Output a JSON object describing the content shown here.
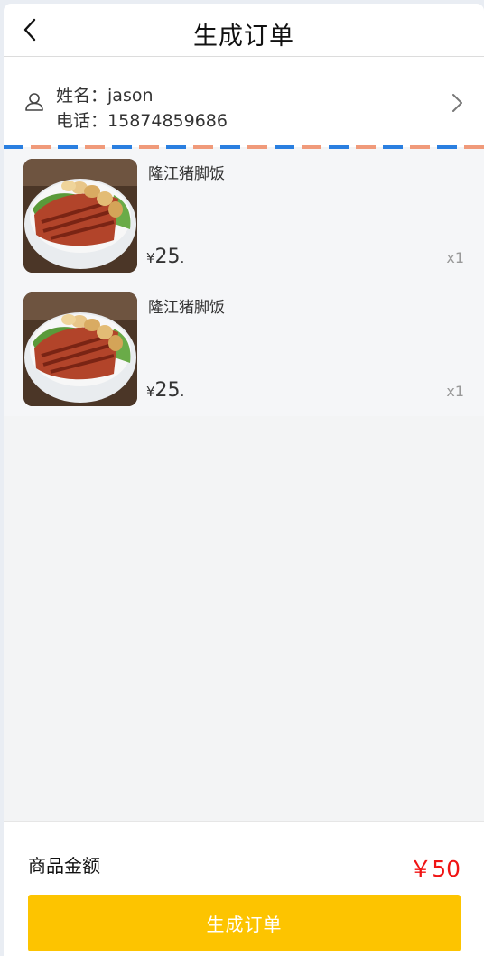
{
  "header": {
    "title": "生成订单",
    "back_icon": "chevron-left-icon"
  },
  "address": {
    "user_icon": "user-icon",
    "name_label": "姓名：",
    "name": "jason",
    "phone_label": "电话：",
    "phone": "15874859686",
    "arrow_icon": "chevron-right-icon"
  },
  "items": [
    {
      "name": "隆江猪脚饭",
      "currency": "¥",
      "price": "25",
      "price_suffix": ".",
      "qty": "x1"
    },
    {
      "name": "隆江猪脚饭",
      "currency": "¥",
      "price": "25",
      "price_suffix": ".",
      "qty": "x1"
    }
  ],
  "footer": {
    "total_label": "商品金额",
    "total_value": "￥50",
    "submit_label": "生成订单"
  },
  "colors": {
    "accent": "#fdc400",
    "price_red": "#f01414",
    "stripe_blue": "#2a7fe0",
    "stripe_orange": "#f09a7a"
  }
}
